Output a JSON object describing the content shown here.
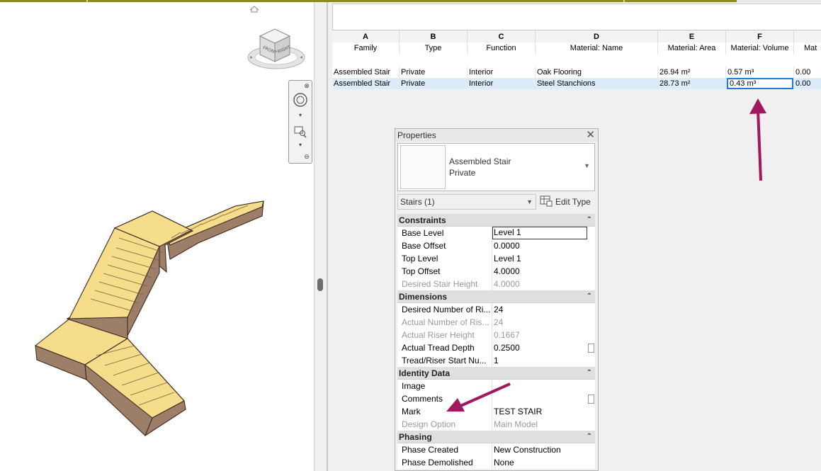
{
  "view3d": {
    "viewcube_faces": [
      "FRONT",
      "RIGHT"
    ]
  },
  "schedule": {
    "col_letters": [
      "A",
      "B",
      "C",
      "D",
      "E",
      "F",
      ""
    ],
    "col_names": [
      "Family",
      "Type",
      "Function",
      "Material: Name",
      "Material: Area",
      "Material: Volume",
      "Mat"
    ],
    "rows": [
      [
        "Assembled Stair",
        "Private",
        "Interior",
        "Oak Flooring",
        "26.94 m²",
        "0.57 m³",
        "0.00"
      ],
      [
        "Assembled Stair",
        "Private",
        "Interior",
        "Steel Stanchions",
        "28.73 m²",
        "0.43 m³",
        "0.00"
      ]
    ]
  },
  "properties": {
    "title": "Properties",
    "type_family": "Assembled Stair",
    "type_name": "Private",
    "filter": "Stairs (1)",
    "edit_type": "Edit Type",
    "groups": {
      "constraints": "Constraints",
      "dimensions": "Dimensions",
      "identity": "Identity Data",
      "phasing": "Phasing"
    },
    "params": {
      "base_level": [
        "Base Level",
        "Level 1"
      ],
      "base_offset": [
        "Base Offset",
        "0.0000"
      ],
      "top_level": [
        "Top Level",
        "Level 1"
      ],
      "top_offset": [
        "Top Offset",
        "4.0000"
      ],
      "desired_height": [
        "Desired Stair Height",
        "4.0000"
      ],
      "desired_risers": [
        "Desired Number of Ri...",
        "24"
      ],
      "actual_risers": [
        "Actual Number of Ris...",
        "24"
      ],
      "actual_riser_height": [
        "Actual Riser Height",
        "0.1667"
      ],
      "actual_tread_depth": [
        "Actual Tread Depth",
        "0.2500"
      ],
      "tread_start": [
        "Tread/Riser Start Nu...",
        "1"
      ],
      "image": [
        "Image",
        ""
      ],
      "comments": [
        "Comments",
        ""
      ],
      "mark": [
        "Mark",
        "TEST STAIR"
      ],
      "design_option": [
        "Design Option",
        "Main Model"
      ],
      "phase_created": [
        "Phase Created",
        "New Construction"
      ],
      "phase_demolished": [
        "Phase Demolished",
        "None"
      ]
    }
  },
  "colors": {
    "annotation_arrow": "#a0185e",
    "stair_tread": "#f6dd8c",
    "stair_side": "#9c7e69",
    "selection": "#1e7bd6"
  }
}
